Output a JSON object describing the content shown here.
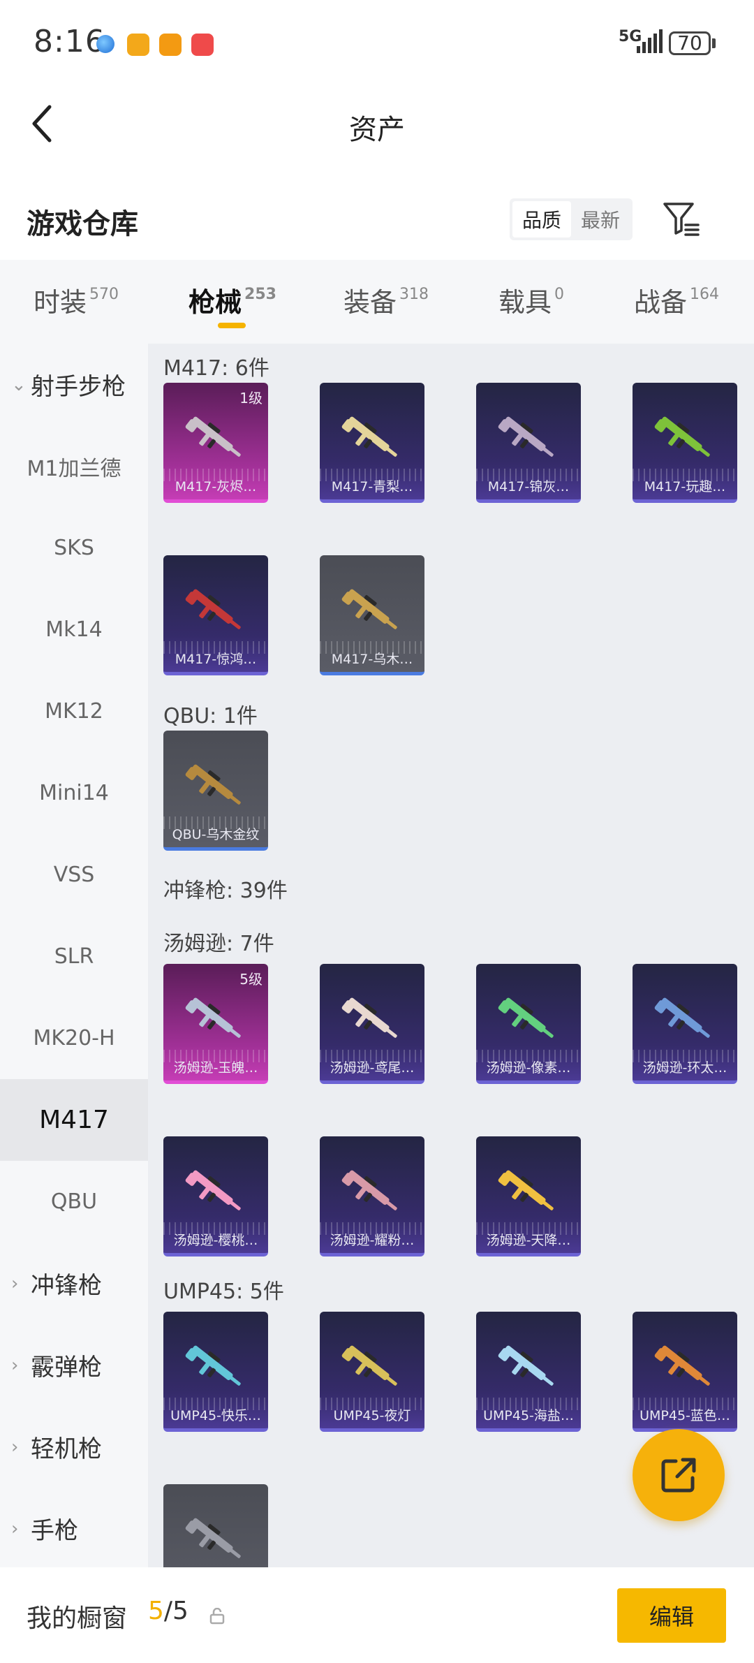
{
  "status_bar": {
    "time": "8:16",
    "network": "5G",
    "battery": "70"
  },
  "header": {
    "title": "资产"
  },
  "warehouse": {
    "title": "游戏仓库",
    "sort_options": [
      "品质",
      "最新"
    ],
    "sort_selected": "品质"
  },
  "tabs": [
    {
      "label": "时装",
      "count": "570"
    },
    {
      "label": "枪械",
      "count": "253"
    },
    {
      "label": "装备",
      "count": "318"
    },
    {
      "label": "载具",
      "count": "0"
    },
    {
      "label": "战备",
      "count": "164"
    }
  ],
  "sidebar": {
    "items": [
      {
        "label": "射手步枪",
        "type": "group-open"
      },
      {
        "label": "M1加兰德",
        "type": "item"
      },
      {
        "label": "SKS",
        "type": "item"
      },
      {
        "label": "Mk14",
        "type": "item"
      },
      {
        "label": "MK12",
        "type": "item"
      },
      {
        "label": "Mini14",
        "type": "item"
      },
      {
        "label": "VSS",
        "type": "item"
      },
      {
        "label": "SLR",
        "type": "item"
      },
      {
        "label": "MK20-H",
        "type": "item"
      },
      {
        "label": "M417",
        "type": "item-selected"
      },
      {
        "label": "QBU",
        "type": "item"
      },
      {
        "label": "冲锋枪",
        "type": "group"
      },
      {
        "label": "霰弹枪",
        "type": "group"
      },
      {
        "label": "轻机枪",
        "type": "group"
      },
      {
        "label": "手枪",
        "type": "group"
      }
    ]
  },
  "content": {
    "sections": [
      {
        "label": "M417: 6件"
      },
      {
        "label": "QBU: 1件"
      },
      {
        "label": "冲锋枪: 39件"
      },
      {
        "label": "汤姆逊: 7件"
      },
      {
        "label": "UMP45: 5件"
      }
    ],
    "cards": [
      {
        "name": "M417-灰烬…",
        "level": "1级",
        "rarity": "pink",
        "gun_color": "#c9c0c8"
      },
      {
        "name": "M417-青梨…",
        "level": "",
        "rarity": "purple",
        "gun_color": "#e4d49a"
      },
      {
        "name": "M417-锦灰…",
        "level": "",
        "rarity": "purple",
        "gun_color": "#b9a8c4"
      },
      {
        "name": "M417-玩趣…",
        "level": "",
        "rarity": "purple",
        "gun_color": "#7ec23a"
      },
      {
        "name": "M417-惊鸿…",
        "level": "",
        "rarity": "purple",
        "gun_color": "#c43838"
      },
      {
        "name": "M417-乌木…",
        "level": "",
        "rarity": "gray",
        "gun_color": "#c9a24f"
      },
      {
        "name": "QBU-乌木金纹",
        "level": "",
        "rarity": "gray",
        "gun_color": "#b68a3e"
      },
      {
        "name": "汤姆逊-玉魄…",
        "level": "5级",
        "rarity": "pink",
        "gun_color": "#b6c2d6"
      },
      {
        "name": "汤姆逊-鸢尾…",
        "level": "",
        "rarity": "purple",
        "gun_color": "#e8d8d0"
      },
      {
        "name": "汤姆逊-像素…",
        "level": "",
        "rarity": "purple",
        "gun_color": "#63d07f"
      },
      {
        "name": "汤姆逊-环太…",
        "level": "",
        "rarity": "purple",
        "gun_color": "#6f9ad8"
      },
      {
        "name": "汤姆逊-樱桃…",
        "level": "",
        "rarity": "purple",
        "gun_color": "#f39ac4"
      },
      {
        "name": "汤姆逊-耀粉…",
        "level": "",
        "rarity": "purple",
        "gun_color": "#d89aa8"
      },
      {
        "name": "汤姆逊-天降…",
        "level": "",
        "rarity": "purple",
        "gun_color": "#f0c040"
      },
      {
        "name": "UMP45-快乐…",
        "level": "",
        "rarity": "purple",
        "gun_color": "#62c6d8"
      },
      {
        "name": "UMP45-夜灯",
        "level": "",
        "rarity": "purple",
        "gun_color": "#d8c05a"
      },
      {
        "name": "UMP45-海盐…",
        "level": "",
        "rarity": "purple",
        "gun_color": "#a8d8f0"
      },
      {
        "name": "UMP45-蓝色…",
        "level": "",
        "rarity": "purple",
        "gun_color": "#e08838"
      },
      {
        "name": "",
        "level": "",
        "rarity": "gray",
        "gun_color": "#9a9ca6"
      }
    ]
  },
  "bottom_bar": {
    "showcase_label": "我的橱窗",
    "showcase_current": "5",
    "showcase_total": "/5",
    "edit_label": "编辑"
  },
  "colors": {
    "accent": "#f6b800",
    "tab_underline": "#f5b300"
  }
}
